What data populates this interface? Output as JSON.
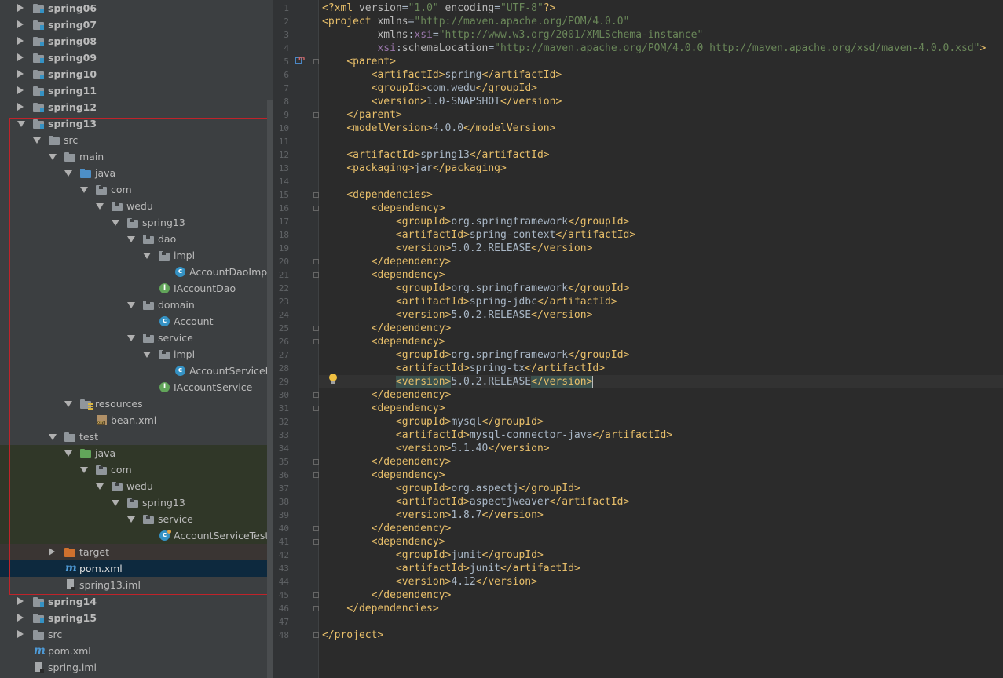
{
  "tree": {
    "rows": [
      {
        "label": "spring06",
        "bold": true,
        "arrow": "right",
        "icon": "module-folder-icon",
        "level": 0
      },
      {
        "label": "spring07",
        "bold": true,
        "arrow": "right",
        "icon": "module-folder-icon",
        "level": 0
      },
      {
        "label": "spring08",
        "bold": true,
        "arrow": "right",
        "icon": "module-folder-icon",
        "level": 0
      },
      {
        "label": "spring09",
        "bold": true,
        "arrow": "right",
        "icon": "module-folder-icon",
        "level": 0
      },
      {
        "label": "spring10",
        "bold": true,
        "arrow": "right",
        "icon": "module-folder-icon",
        "level": 0
      },
      {
        "label": "spring11",
        "bold": true,
        "arrow": "right",
        "icon": "module-folder-icon",
        "level": 0
      },
      {
        "label": "spring12",
        "bold": true,
        "arrow": "right",
        "icon": "module-folder-icon",
        "level": 0
      },
      {
        "label": "spring13",
        "bold": true,
        "arrow": "down",
        "icon": "module-folder-icon",
        "level": 0
      },
      {
        "label": "src",
        "arrow": "down",
        "icon": "folder-icon",
        "level": 1
      },
      {
        "label": "main",
        "arrow": "down",
        "icon": "folder-icon",
        "level": 2
      },
      {
        "label": "java",
        "arrow": "down",
        "icon": "source-root-folder-icon",
        "level": 3
      },
      {
        "label": "com",
        "arrow": "down",
        "icon": "package-icon",
        "level": 4
      },
      {
        "label": "wedu",
        "arrow": "down",
        "icon": "package-icon",
        "level": 5
      },
      {
        "label": "spring13",
        "arrow": "down",
        "icon": "package-icon",
        "level": 6
      },
      {
        "label": "dao",
        "arrow": "down",
        "icon": "package-icon",
        "level": 7
      },
      {
        "label": "impl",
        "arrow": "down",
        "icon": "package-icon",
        "level": 8
      },
      {
        "label": "AccountDaoImpl",
        "icon": "class-icon",
        "level": 9
      },
      {
        "label": "IAccountDao",
        "icon": "interface-icon",
        "level": 8
      },
      {
        "label": "domain",
        "arrow": "down",
        "icon": "package-icon",
        "level": 7
      },
      {
        "label": "Account",
        "icon": "class-icon",
        "level": 8
      },
      {
        "label": "service",
        "arrow": "down",
        "icon": "package-icon",
        "level": 7
      },
      {
        "label": "impl",
        "arrow": "down",
        "icon": "package-icon",
        "level": 8
      },
      {
        "label": "AccountServiceImp",
        "icon": "class-icon",
        "level": 9
      },
      {
        "label": "IAccountService",
        "icon": "interface-icon",
        "level": 8
      },
      {
        "label": "resources",
        "arrow": "down",
        "icon": "resources-folder-icon",
        "level": 3
      },
      {
        "label": "bean.xml",
        "icon": "xml-file-icon",
        "level": 4
      },
      {
        "label": "test",
        "arrow": "down",
        "icon": "folder-icon",
        "level": 2
      },
      {
        "label": "java",
        "arrow": "down",
        "icon": "test-root-folder-icon",
        "level": 3,
        "bg": "test"
      },
      {
        "label": "com",
        "arrow": "down",
        "icon": "package-icon",
        "level": 4,
        "bg": "test"
      },
      {
        "label": "wedu",
        "arrow": "down",
        "icon": "package-icon",
        "level": 5,
        "bg": "test"
      },
      {
        "label": "spring13",
        "arrow": "down",
        "icon": "package-icon",
        "level": 6,
        "bg": "test"
      },
      {
        "label": "service",
        "arrow": "down",
        "icon": "package-icon",
        "level": 7,
        "bg": "test"
      },
      {
        "label": "AccountServiceTest",
        "icon": "test-class-icon",
        "level": 8,
        "bg": "test"
      },
      {
        "label": "target",
        "arrow": "right",
        "icon": "excluded-folder-icon",
        "level": 2,
        "bg": "excluded"
      },
      {
        "label": "pom.xml",
        "icon": "maven-icon",
        "level": 2,
        "bg": "selected"
      },
      {
        "label": "spring13.iml",
        "icon": "iml-file-icon",
        "level": 2
      },
      {
        "label": "spring14",
        "bold": true,
        "arrow": "right",
        "icon": "module-folder-icon",
        "level": 0
      },
      {
        "label": "spring15",
        "bold": true,
        "arrow": "right",
        "icon": "module-folder-icon",
        "level": 0
      },
      {
        "label": "src",
        "arrow": "right",
        "icon": "folder-icon",
        "level": 0
      },
      {
        "label": "pom.xml",
        "icon": "maven-icon",
        "level": 0
      },
      {
        "label": "spring.iml",
        "icon": "iml-file-icon",
        "level": 0
      }
    ]
  },
  "editor": {
    "current_line": 29,
    "lines": [
      [
        [
          "tag",
          "<?xml "
        ],
        [
          "attr",
          "version"
        ],
        [
          "txt",
          "="
        ],
        [
          "str",
          "\"1.0\""
        ],
        [
          "attr",
          " encoding"
        ],
        [
          "txt",
          "="
        ],
        [
          "str",
          "\"UTF-8\""
        ],
        [
          "tag",
          "?>"
        ]
      ],
      [
        [
          "tag",
          "<project "
        ],
        [
          "attr",
          "xmlns"
        ],
        [
          "txt",
          "="
        ],
        [
          "str",
          "\"http://maven.apache.org/POM/4.0.0\""
        ]
      ],
      [
        [
          "txt",
          "         "
        ],
        [
          "attr",
          "xmlns"
        ],
        [
          "txt",
          ":"
        ],
        [
          "ns",
          "xsi"
        ],
        [
          "txt",
          "="
        ],
        [
          "str",
          "\"http://www.w3.org/2001/XMLSchema-instance\""
        ]
      ],
      [
        [
          "txt",
          "         "
        ],
        [
          "ns",
          "xsi"
        ],
        [
          "txt",
          ":"
        ],
        [
          "attr",
          "schemaLocation"
        ],
        [
          "txt",
          "="
        ],
        [
          "str",
          "\"http://maven.apache.org/POM/4.0.0 http://maven.apache.org/xsd/maven-4.0.0.xsd\""
        ],
        [
          "tag",
          ">"
        ]
      ],
      [
        [
          "txt",
          "    "
        ],
        [
          "tag",
          "<parent>"
        ]
      ],
      [
        [
          "txt",
          "        "
        ],
        [
          "tag",
          "<artifactId>"
        ],
        [
          "txt",
          "spring"
        ],
        [
          "tag",
          "</artifactId>"
        ]
      ],
      [
        [
          "txt",
          "        "
        ],
        [
          "tag",
          "<groupId>"
        ],
        [
          "txt",
          "com.wedu"
        ],
        [
          "tag",
          "</groupId>"
        ]
      ],
      [
        [
          "txt",
          "        "
        ],
        [
          "tag",
          "<version>"
        ],
        [
          "txt",
          "1.0-SNAPSHOT"
        ],
        [
          "tag",
          "</version>"
        ]
      ],
      [
        [
          "txt",
          "    "
        ],
        [
          "tag",
          "</parent>"
        ]
      ],
      [
        [
          "txt",
          "    "
        ],
        [
          "tag",
          "<modelVersion>"
        ],
        [
          "txt",
          "4.0.0"
        ],
        [
          "tag",
          "</modelVersion>"
        ]
      ],
      [],
      [
        [
          "txt",
          "    "
        ],
        [
          "tag",
          "<artifactId>"
        ],
        [
          "txt",
          "spring13"
        ],
        [
          "tag",
          "</artifactId>"
        ]
      ],
      [
        [
          "txt",
          "    "
        ],
        [
          "tag",
          "<packaging>"
        ],
        [
          "txt",
          "jar"
        ],
        [
          "tag",
          "</packaging>"
        ]
      ],
      [],
      [
        [
          "txt",
          "    "
        ],
        [
          "tag",
          "<dependencies>"
        ]
      ],
      [
        [
          "txt",
          "        "
        ],
        [
          "tag",
          "<dependency>"
        ]
      ],
      [
        [
          "txt",
          "            "
        ],
        [
          "tag",
          "<groupId>"
        ],
        [
          "txt",
          "org.springframework"
        ],
        [
          "tag",
          "</groupId>"
        ]
      ],
      [
        [
          "txt",
          "            "
        ],
        [
          "tag",
          "<artifactId>"
        ],
        [
          "txt",
          "spring-context"
        ],
        [
          "tag",
          "</artifactId>"
        ]
      ],
      [
        [
          "txt",
          "            "
        ],
        [
          "tag",
          "<version>"
        ],
        [
          "txt",
          "5.0.2.RELEASE"
        ],
        [
          "tag",
          "</version>"
        ]
      ],
      [
        [
          "txt",
          "        "
        ],
        [
          "tag",
          "</dependency>"
        ]
      ],
      [
        [
          "txt",
          "        "
        ],
        [
          "tag",
          "<dependency>"
        ]
      ],
      [
        [
          "txt",
          "            "
        ],
        [
          "tag",
          "<groupId>"
        ],
        [
          "txt",
          "org.springframework"
        ],
        [
          "tag",
          "</groupId>"
        ]
      ],
      [
        [
          "txt",
          "            "
        ],
        [
          "tag",
          "<artifactId>"
        ],
        [
          "txt",
          "spring-jdbc"
        ],
        [
          "tag",
          "</artifactId>"
        ]
      ],
      [
        [
          "txt",
          "            "
        ],
        [
          "tag",
          "<version>"
        ],
        [
          "txt",
          "5.0.2.RELEASE"
        ],
        [
          "tag",
          "</version>"
        ]
      ],
      [
        [
          "txt",
          "        "
        ],
        [
          "tag",
          "</dependency>"
        ]
      ],
      [
        [
          "txt",
          "        "
        ],
        [
          "tag",
          "<dependency>"
        ]
      ],
      [
        [
          "txt",
          "            "
        ],
        [
          "tag",
          "<groupId>"
        ],
        [
          "txt",
          "org.springframework"
        ],
        [
          "tag",
          "</groupId>"
        ]
      ],
      [
        [
          "txt",
          "            "
        ],
        [
          "tag",
          "<artifactId>"
        ],
        [
          "txt",
          "spring-tx"
        ],
        [
          "tag",
          "</artifactId>"
        ]
      ],
      [
        [
          "txt",
          "            "
        ],
        [
          "tagh",
          "<version>"
        ],
        [
          "txt",
          "5.0.2.RELEASE"
        ],
        [
          "tagh",
          "</version>"
        ]
      ],
      [
        [
          "txt",
          "        "
        ],
        [
          "tag",
          "</dependency>"
        ]
      ],
      [
        [
          "txt",
          "        "
        ],
        [
          "tag",
          "<dependency>"
        ]
      ],
      [
        [
          "txt",
          "            "
        ],
        [
          "tag",
          "<groupId>"
        ],
        [
          "txt",
          "mysql"
        ],
        [
          "tag",
          "</groupId>"
        ]
      ],
      [
        [
          "txt",
          "            "
        ],
        [
          "tag",
          "<artifactId>"
        ],
        [
          "txt",
          "mysql-connector-java"
        ],
        [
          "tag",
          "</artifactId>"
        ]
      ],
      [
        [
          "txt",
          "            "
        ],
        [
          "tag",
          "<version>"
        ],
        [
          "txt",
          "5.1.40"
        ],
        [
          "tag",
          "</version>"
        ]
      ],
      [
        [
          "txt",
          "        "
        ],
        [
          "tag",
          "</dependency>"
        ]
      ],
      [
        [
          "txt",
          "        "
        ],
        [
          "tag",
          "<dependency>"
        ]
      ],
      [
        [
          "txt",
          "            "
        ],
        [
          "tag",
          "<groupId>"
        ],
        [
          "txt",
          "org.aspectj"
        ],
        [
          "tag",
          "</groupId>"
        ]
      ],
      [
        [
          "txt",
          "            "
        ],
        [
          "tag",
          "<artifactId>"
        ],
        [
          "txt",
          "aspectjweaver"
        ],
        [
          "tag",
          "</artifactId>"
        ]
      ],
      [
        [
          "txt",
          "            "
        ],
        [
          "tag",
          "<version>"
        ],
        [
          "txt",
          "1.8.7"
        ],
        [
          "tag",
          "</version>"
        ]
      ],
      [
        [
          "txt",
          "        "
        ],
        [
          "tag",
          "</dependency>"
        ]
      ],
      [
        [
          "txt",
          "        "
        ],
        [
          "tag",
          "<dependency>"
        ]
      ],
      [
        [
          "txt",
          "            "
        ],
        [
          "tag",
          "<groupId>"
        ],
        [
          "txt",
          "junit"
        ],
        [
          "tag",
          "</groupId>"
        ]
      ],
      [
        [
          "txt",
          "            "
        ],
        [
          "tag",
          "<artifactId>"
        ],
        [
          "txt",
          "junit"
        ],
        [
          "tag",
          "</artifactId>"
        ]
      ],
      [
        [
          "txt",
          "            "
        ],
        [
          "tag",
          "<version>"
        ],
        [
          "txt",
          "4.12"
        ],
        [
          "tag",
          "</version>"
        ]
      ],
      [
        [
          "txt",
          "        "
        ],
        [
          "tag",
          "</dependency>"
        ]
      ],
      [
        [
          "txt",
          "    "
        ],
        [
          "tag",
          "</dependencies>"
        ]
      ],
      [],
      [
        [
          "tag",
          "</project>"
        ]
      ]
    ],
    "fold_markers": [
      5,
      9,
      15,
      16,
      20,
      21,
      25,
      26,
      30,
      31,
      35,
      36,
      40,
      41,
      45,
      46,
      48
    ]
  }
}
